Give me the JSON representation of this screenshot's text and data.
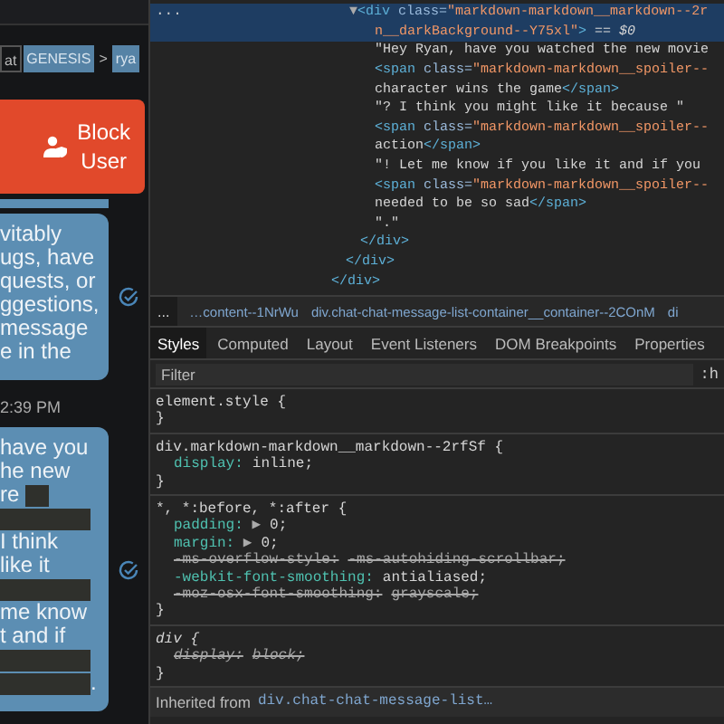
{
  "chat": {
    "breadcrumbs": [
      {
        "label": "at",
        "kind": "plain"
      },
      {
        "label": "GENESIS",
        "kind": "chip"
      },
      {
        "label": ">",
        "kind": "separator"
      },
      {
        "label": "rya",
        "kind": "chip"
      }
    ],
    "block_button": {
      "label_lines": [
        "Block",
        "User"
      ]
    },
    "messages": [
      {
        "lines": [
          [
            {
              "kind": "text",
              "text": "vitably"
            }
          ],
          [
            {
              "kind": "text",
              "text": "ugs, have"
            }
          ],
          [
            {
              "kind": "text",
              "text": "quests, or"
            }
          ],
          [
            {
              "kind": "text",
              "text": "ggestions,"
            }
          ],
          [
            {
              "kind": "text",
              "text": " message"
            }
          ],
          [
            {
              "kind": "text",
              "text": "e in the"
            }
          ]
        ],
        "read": true
      },
      {
        "time": "2:39 PM",
        "lines": [
          [
            {
              "kind": "text",
              "text": " have you"
            }
          ],
          [
            {
              "kind": "text",
              "text": "he new"
            }
          ],
          [
            {
              "kind": "text",
              "text": "re"
            },
            {
              "kind": "spoiler"
            }
          ],
          [
            {
              "kind": "spoiler"
            }
          ],
          [
            {
              "kind": "text",
              "text": " I think"
            }
          ],
          [
            {
              "kind": "text",
              "text": "like it"
            }
          ],
          [
            {
              "kind": "spoiler"
            }
          ],
          [
            {
              "kind": "text",
              "text": " me know"
            }
          ],
          [
            {
              "kind": "text",
              "text": "t and if"
            }
          ],
          [
            {
              "kind": "spoiler"
            }
          ],
          [
            {
              "kind": "spoiler"
            },
            {
              "kind": "text",
              "text": "."
            }
          ]
        ],
        "read": true
      }
    ]
  },
  "devtools": {
    "gutter": "...",
    "tree": [
      {
        "close": "</div>",
        "children": [
          {
            "close": "</div>",
            "children": [
              {
                "selected": true,
                "arrow": "▼",
                "lines": [
                  [
                    {
                      "kind": "tag",
                      "text": "<div "
                    },
                    {
                      "kind": "attr",
                      "text": "class="
                    },
                    {
                      "kind": "value",
                      "text": "\"markdown-markdown__markdown--2r"
                    }
                  ],
                  [
                    {
                      "kind": "value",
                      "text": "n__darkBackground--Y75xl\""
                    },
                    {
                      "kind": "tag",
                      "text": ">"
                    },
                    {
                      "kind": "meta",
                      "text": " == $0"
                    }
                  ]
                ],
                "close": "</div>",
                "children": [
                  {
                    "selected": false,
                    "lines": [
                      [
                        {
                          "kind": "text",
                          "text": "\"Hey Ryan, have you watched the new movie"
                        }
                      ]
                    ]
                  },
                  {
                    "selected": false,
                    "lines": [
                      [
                        {
                          "kind": "tag",
                          "text": "<span "
                        },
                        {
                          "kind": "attr",
                          "text": "class="
                        },
                        {
                          "kind": "value",
                          "text": "\"markdown-markdown__spoiler--"
                        }
                      ],
                      [
                        {
                          "kind": "text",
                          "text": "character wins the game"
                        },
                        {
                          "kind": "tag",
                          "text": "</span>"
                        }
                      ]
                    ]
                  },
                  {
                    "selected": false,
                    "lines": [
                      [
                        {
                          "kind": "text",
                          "text": "\"? I think you might like it because \""
                        }
                      ]
                    ]
                  },
                  {
                    "selected": false,
                    "lines": [
                      [
                        {
                          "kind": "tag",
                          "text": "<span "
                        },
                        {
                          "kind": "attr",
                          "text": "class="
                        },
                        {
                          "kind": "value",
                          "text": "\"markdown-markdown__spoiler--"
                        }
                      ],
                      [
                        {
                          "kind": "text",
                          "text": "action"
                        },
                        {
                          "kind": "tag",
                          "text": "</span>"
                        }
                      ]
                    ]
                  },
                  {
                    "selected": false,
                    "lines": [
                      [
                        {
                          "kind": "text",
                          "text": "\"! Let me know if you like it and if you"
                        }
                      ]
                    ]
                  },
                  {
                    "selected": false,
                    "lines": [
                      [
                        {
                          "kind": "tag",
                          "text": "<span "
                        },
                        {
                          "kind": "attr",
                          "text": "class="
                        },
                        {
                          "kind": "value",
                          "text": "\"markdown-markdown__spoiler--"
                        }
                      ],
                      [
                        {
                          "kind": "text",
                          "text": "needed to be so sad"
                        },
                        {
                          "kind": "tag",
                          "text": "</span>"
                        }
                      ]
                    ]
                  },
                  {
                    "selected": false,
                    "lines": [
                      [
                        {
                          "kind": "text",
                          "text": "\".\""
                        }
                      ]
                    ]
                  }
                ]
              }
            ]
          }
        ]
      }
    ],
    "breadcrumb_more": "...",
    "breadcrumbs": [
      "…content--1NrWu",
      "div.chat-chat-message-list-container__container--2COnM",
      "di"
    ],
    "tabs": [
      {
        "label": "Styles",
        "selected": true
      },
      {
        "label": "Computed",
        "selected": false
      },
      {
        "label": "Layout",
        "selected": false
      },
      {
        "label": "Event Listeners",
        "selected": false
      },
      {
        "label": "DOM Breakpoints",
        "selected": false
      },
      {
        "label": "Properties",
        "selected": false
      }
    ],
    "filter": {
      "placeholder": "Filter",
      "hov": ":h"
    },
    "rules": [
      {
        "selector": "element.style {",
        "italic": false,
        "close": "}"
      },
      {
        "selector": "div.markdown-markdown__markdown--2rfSf {",
        "italic": false,
        "declarations": [
          {
            "name": "display:",
            "value": "inline;",
            "struck": false
          }
        ],
        "close": "}"
      },
      {
        "selector": "*, *:before, *:after {",
        "italic": false,
        "declarations": [
          {
            "name": "padding:",
            "value": "0;",
            "expander": "▶",
            "struck": false
          },
          {
            "name": "margin:",
            "value": "0;",
            "expander": "▶",
            "struck": false
          },
          {
            "name": "-ms-overflow-style:",
            "value": "-ms-autohiding-scrollbar;",
            "struck": true
          },
          {
            "name": "-webkit-font-smoothing:",
            "value": "antialiased;",
            "struck": false
          },
          {
            "name": "-moz-osx-font-smoothing:",
            "value": "grayscale;",
            "struck": true
          }
        ],
        "close": "}"
      },
      {
        "selector": "div {",
        "italic": true,
        "declarations": [
          {
            "name": "display:",
            "value": "block;",
            "struck": true
          }
        ],
        "close": "}"
      }
    ],
    "inherited": {
      "label": "Inherited from",
      "selector": "div.chat-chat-message-list…"
    }
  }
}
